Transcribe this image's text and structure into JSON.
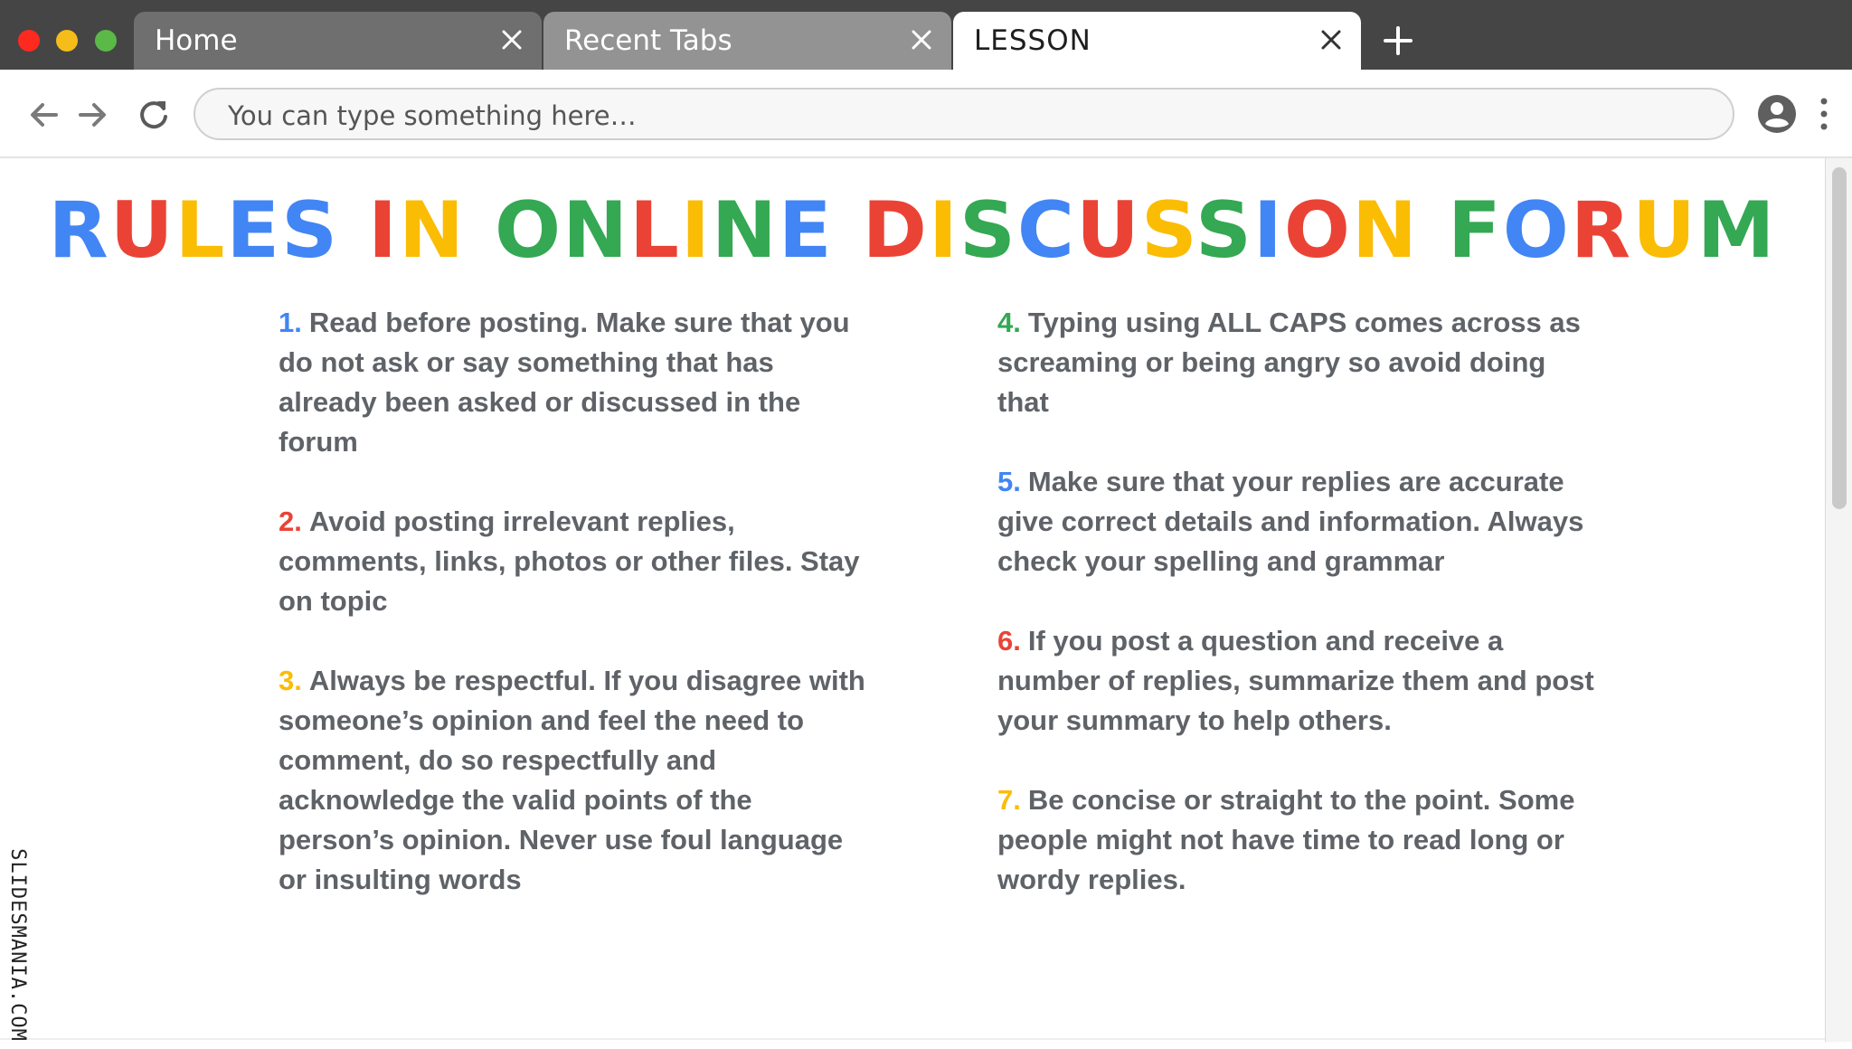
{
  "colors": {
    "blue": "#4285f4",
    "red": "#ea4335",
    "yellow": "#fbbc04",
    "green": "#34a853",
    "text_gray": "#5f6368",
    "tab_bar": "#454545"
  },
  "window": {
    "traffic_lights": [
      "close",
      "minimize",
      "zoom"
    ]
  },
  "tabs": [
    {
      "label": "Home",
      "active": false
    },
    {
      "label": "Recent Tabs",
      "active": false
    },
    {
      "label": "LESSON",
      "active": true
    }
  ],
  "toolbar": {
    "address_placeholder": "You can type something here…",
    "icons": [
      "back-arrow-icon",
      "forward-arrow-icon",
      "reload-icon",
      "account-icon",
      "more-vert-icon"
    ]
  },
  "page": {
    "title_words": [
      [
        {
          "t": "R",
          "c": "blue"
        },
        {
          "t": "U",
          "c": "red"
        },
        {
          "t": "L",
          "c": "yellow"
        },
        {
          "t": "E",
          "c": "blue"
        },
        {
          "t": "S",
          "c": "blue"
        }
      ],
      [
        {
          "t": "I",
          "c": "red"
        },
        {
          "t": "N",
          "c": "yellow"
        }
      ],
      [
        {
          "t": "O",
          "c": "green"
        },
        {
          "t": "N",
          "c": "green"
        },
        {
          "t": "L",
          "c": "red"
        },
        {
          "t": "I",
          "c": "yellow"
        },
        {
          "t": "N",
          "c": "green"
        },
        {
          "t": "E",
          "c": "blue"
        }
      ],
      [
        {
          "t": "D",
          "c": "red"
        },
        {
          "t": "I",
          "c": "yellow"
        },
        {
          "t": "S",
          "c": "green"
        },
        {
          "t": "C",
          "c": "blue"
        },
        {
          "t": "U",
          "c": "red"
        },
        {
          "t": "S",
          "c": "yellow"
        },
        {
          "t": "S",
          "c": "green"
        },
        {
          "t": "I",
          "c": "blue"
        },
        {
          "t": "O",
          "c": "red"
        },
        {
          "t": "N",
          "c": "yellow"
        }
      ],
      [
        {
          "t": "F",
          "c": "green"
        },
        {
          "t": "O",
          "c": "blue"
        },
        {
          "t": "R",
          "c": "red"
        },
        {
          "t": "U",
          "c": "yellow"
        },
        {
          "t": "M",
          "c": "green"
        }
      ]
    ],
    "rules_left": [
      {
        "num": "1.",
        "color": "blue",
        "text": "Read before posting. Make sure that you do not ask or say something that has already been asked or discussed in the forum"
      },
      {
        "num": "2.",
        "color": "red",
        "text": "Avoid posting irrelevant replies, comments, links, photos or other files. Stay on topic"
      },
      {
        "num": "3.",
        "color": "yellow",
        "text": "Always be respectful. If you disagree with someone’s opinion and feel the need to comment, do so respectfully and acknowledge the valid points of the person’s opinion. Never use foul language or insulting words"
      }
    ],
    "rules_right": [
      {
        "num": "4.",
        "color": "green",
        "text": "Typing using ALL CAPS comes across as screaming or being angry so avoid doing that"
      },
      {
        "num": "5.",
        "color": "blue",
        "text": "Make sure that your replies are accurate give correct details and information. Always check your spelling and grammar"
      },
      {
        "num": "6.",
        "color": "red",
        "text": "If you post a question and receive a number of replies, summarize them and post your summary to help others."
      },
      {
        "num": "7.",
        "color": "yellow",
        "text": "Be concise or straight to the point. Some people might not have time to read long or wordy replies."
      }
    ],
    "watermark": "SLIDESMANIA.COM"
  }
}
